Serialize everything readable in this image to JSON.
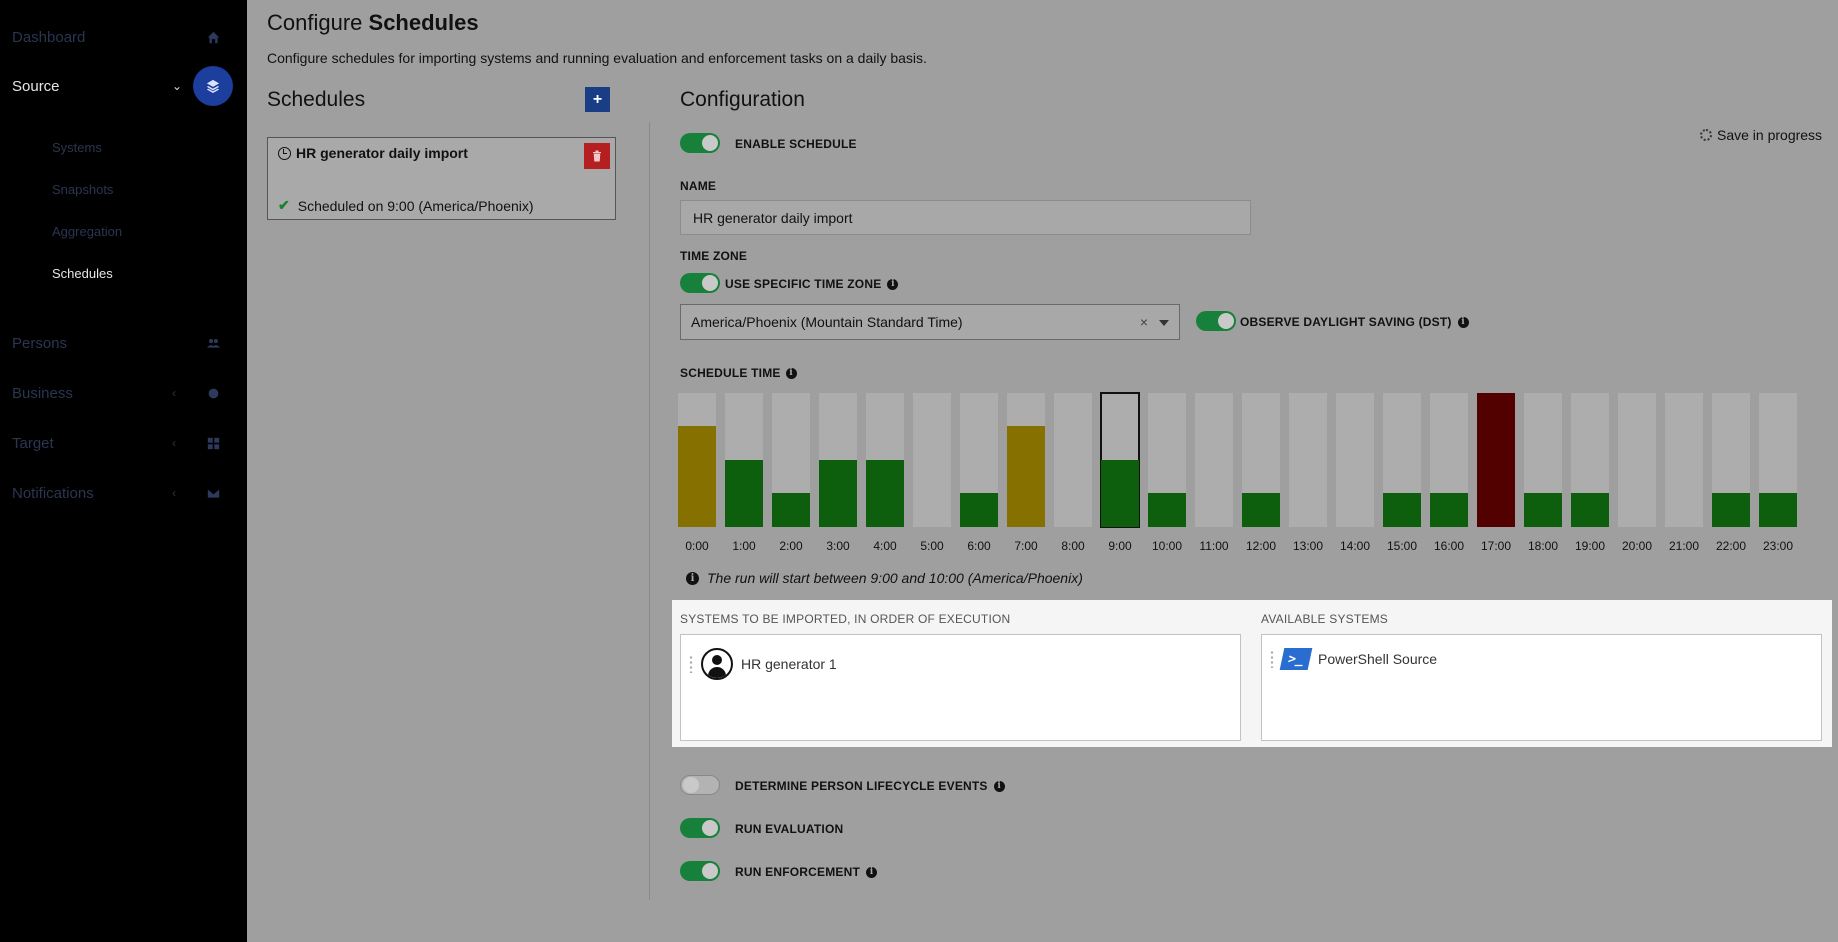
{
  "sidebar": {
    "items": [
      {
        "label": "Dashboard",
        "icon": "home-icon"
      },
      {
        "label": "Source",
        "icon": "layers-icon",
        "active": true
      },
      {
        "label": "Persons",
        "icon": "users-icon"
      },
      {
        "label": "Business",
        "icon": "sitemap-icon"
      },
      {
        "label": "Target",
        "icon": "grid-icon"
      },
      {
        "label": "Notifications",
        "icon": "envelope-icon"
      }
    ],
    "source_sub": [
      "Systems",
      "Snapshots",
      "Aggregation",
      "Schedules"
    ],
    "active_sub": "Schedules"
  },
  "page": {
    "title_prefix": "Configure",
    "title_bold": "Schedules",
    "description": "Configure schedules for importing systems and running evaluation and enforcement tasks on a daily basis."
  },
  "schedules": {
    "heading": "Schedules",
    "add_label": "+",
    "card": {
      "title": "HR generator daily import",
      "status": "Scheduled on 9:00 (America/Phoenix)"
    }
  },
  "config": {
    "heading": "Configuration",
    "save_status": "Save in progress",
    "enable_schedule": {
      "label": "ENABLE SCHEDULE",
      "on": true
    },
    "name": {
      "label": "NAME",
      "value": "HR generator daily import"
    },
    "time_zone": {
      "label": "TIME ZONE",
      "use_specific": {
        "label": "USE SPECIFIC TIME ZONE",
        "on": true
      },
      "selected": "America/Phoenix (Mountain Standard Time)",
      "clear": "×",
      "dst": {
        "label": "OBSERVE DAYLIGHT SAVING (DST)",
        "on": true
      }
    },
    "schedule_time": {
      "label": "SCHEDULE TIME",
      "selected_hour": "9:00",
      "hours": [
        {
          "hour": "0:00",
          "level": 0.75,
          "status": "warning"
        },
        {
          "hour": "1:00",
          "level": 0.5,
          "status": "ok"
        },
        {
          "hour": "2:00",
          "level": 0.25,
          "status": "ok"
        },
        {
          "hour": "3:00",
          "level": 0.5,
          "status": "ok"
        },
        {
          "hour": "4:00",
          "level": 0.5,
          "status": "ok"
        },
        {
          "hour": "5:00",
          "level": 0,
          "status": "none"
        },
        {
          "hour": "6:00",
          "level": 0.25,
          "status": "ok"
        },
        {
          "hour": "7:00",
          "level": 0.75,
          "status": "warning"
        },
        {
          "hour": "8:00",
          "level": 0,
          "status": "none"
        },
        {
          "hour": "9:00",
          "level": 0.5,
          "status": "ok"
        },
        {
          "hour": "10:00",
          "level": 0.25,
          "status": "ok"
        },
        {
          "hour": "11:00",
          "level": 0,
          "status": "none"
        },
        {
          "hour": "12:00",
          "level": 0.25,
          "status": "ok"
        },
        {
          "hour": "13:00",
          "level": 0,
          "status": "none"
        },
        {
          "hour": "14:00",
          "level": 0,
          "status": "none"
        },
        {
          "hour": "15:00",
          "level": 0.25,
          "status": "ok"
        },
        {
          "hour": "16:00",
          "level": 0.25,
          "status": "ok"
        },
        {
          "hour": "17:00",
          "level": 1,
          "status": "error"
        },
        {
          "hour": "18:00",
          "level": 0.25,
          "status": "ok"
        },
        {
          "hour": "19:00",
          "level": 0.25,
          "status": "ok"
        },
        {
          "hour": "20:00",
          "level": 0,
          "status": "none"
        },
        {
          "hour": "21:00",
          "level": 0,
          "status": "none"
        },
        {
          "hour": "22:00",
          "level": 0.25,
          "status": "ok"
        },
        {
          "hour": "23:00",
          "level": 0.25,
          "status": "ok"
        }
      ],
      "run_note": "The run will start between 9:00 and 10:00 (America/Phoenix)"
    },
    "systems": {
      "imported_heading": "SYSTEMS TO BE IMPORTED, IN ORDER OF EXECUTION",
      "imported": [
        {
          "name": "HR generator 1",
          "icon": "person-icon"
        }
      ],
      "available_heading": "AVAILABLE SYSTEMS",
      "available": [
        {
          "name": "PowerShell Source",
          "icon": "powershell-icon"
        }
      ]
    },
    "lifecycle": {
      "label": "DETERMINE PERSON LIFECYCLE EVENTS",
      "on": false
    },
    "evaluation": {
      "label": "RUN EVALUATION",
      "on": true
    },
    "enforcement": {
      "label": "RUN ENFORCEMENT",
      "on": true
    }
  },
  "colors": {
    "ok": "#0d5f0d",
    "warning": "#857000",
    "error": "#520000",
    "toggle_on": "#17803a",
    "accent": "#1c3e9c"
  }
}
